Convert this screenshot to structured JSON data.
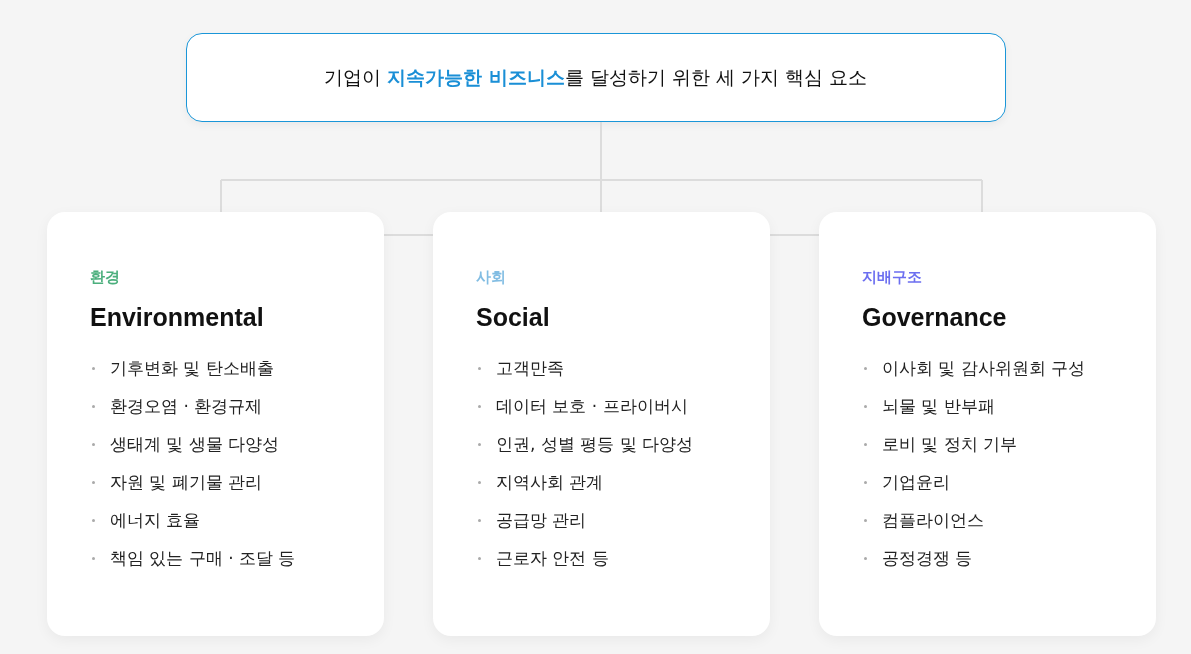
{
  "title": "기업이 **지속가능한 비즈니스**를 달성하기 위한 세 가지 핵심 요소",
  "cards": [
    {
      "label": "환경",
      "color": "#4caf7d",
      "heading": "Environmental",
      "items": [
        "기후변화 및 탄소배출",
        "환경오염 · 환경규제",
        "생태계 및 생물 다양성",
        "자원 및 폐기물 관리",
        "에너지 효율",
        "책임 있는 구매 · 조달 등"
      ]
    },
    {
      "label": "사회",
      "color": "#82bde3",
      "heading": "Social",
      "items": [
        "고객만족",
        "데이터 보호 · 프라이버시",
        "인권, 성별 평등 및 다양성",
        "지역사회 관계",
        "공급망 관리",
        "근로자 안전 등"
      ]
    },
    {
      "label": "지배구조",
      "color": "#6c6ff0",
      "heading": "Governance",
      "items": [
        "이사회 및 감사위원회 구성",
        "뇌물 및 반부패",
        "로비 및 정치 기부",
        "기업윤리",
        "컴플라이언스",
        "공정경쟁 등"
      ]
    }
  ]
}
